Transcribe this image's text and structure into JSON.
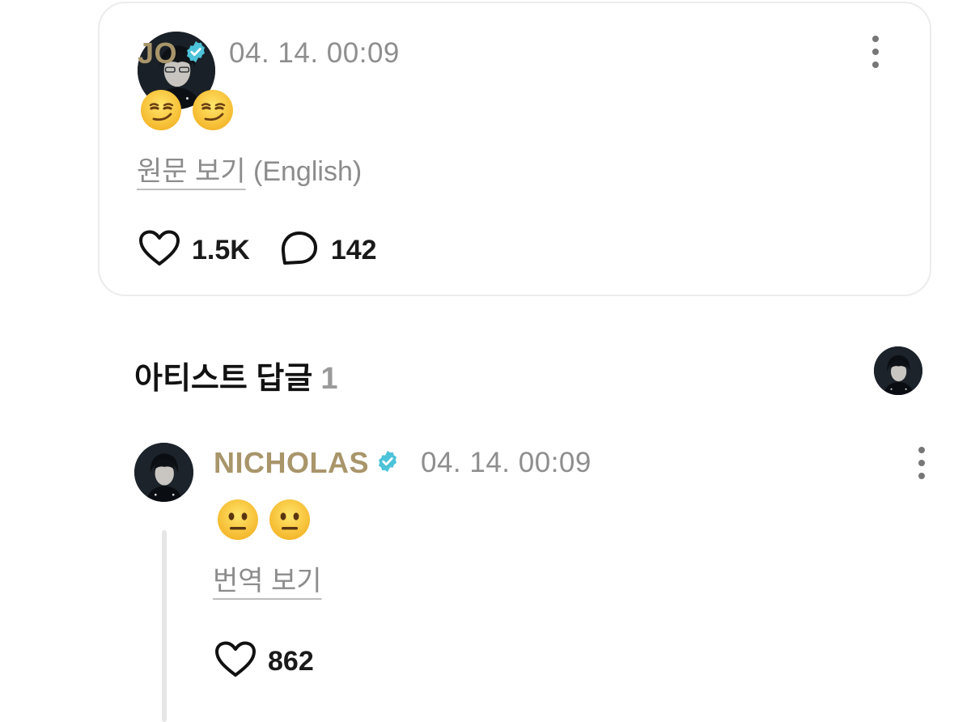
{
  "post": {
    "author": "JO",
    "timestamp": "04. 14. 00:09",
    "content_emojis": [
      "smirk-face",
      "smirk-face"
    ],
    "translate_link": "원문 보기",
    "translate_lang": " (English)",
    "likes": "1.5K",
    "comments": "142"
  },
  "artist_replies": {
    "title": "아티스트 답글",
    "count": "1"
  },
  "reply": {
    "author": "NICHOLAS",
    "timestamp": "04. 14. 00:09",
    "content_emojis": [
      "neutral-face",
      "neutral-face"
    ],
    "translate_link": "번역 보기",
    "likes": "862"
  },
  "colors": {
    "author_name": "#a8956a",
    "verified_badge": "#4cc3d9",
    "timestamp": "#8e8e8e",
    "card_border": "#ececec"
  }
}
